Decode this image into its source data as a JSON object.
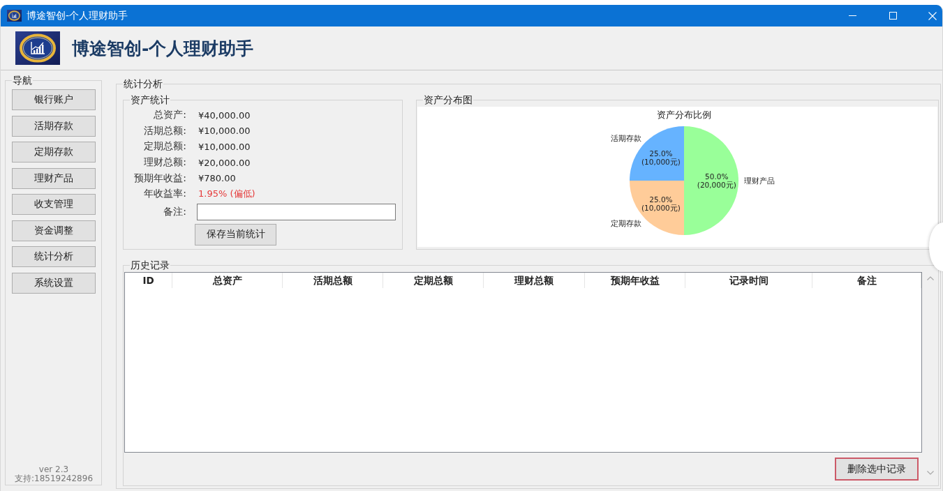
{
  "window": {
    "title": "博途智创-个人理财助手"
  },
  "header": {
    "title": "博途智创-个人理财助手"
  },
  "nav": {
    "title": "导航",
    "items": [
      "银行账户",
      "活期存款",
      "定期存款",
      "理财产品",
      "收支管理",
      "资金调整",
      "统计分析",
      "系统设置"
    ],
    "footer": {
      "version": "ver 2.3",
      "support": "支持:18519242896"
    }
  },
  "panel": {
    "title": "统计分析",
    "summary": {
      "title": "资产统计",
      "rows": [
        {
          "label": "总资产:",
          "value": "¥40,000.00",
          "alert": false
        },
        {
          "label": "活期总额:",
          "value": "¥10,000.00",
          "alert": false
        },
        {
          "label": "定期总额:",
          "value": "¥10,000.00",
          "alert": false
        },
        {
          "label": "理财总额:",
          "value": "¥20,000.00",
          "alert": false
        },
        {
          "label": "预期年收益:",
          "value": "¥780.00",
          "alert": false
        },
        {
          "label": "年收益率:",
          "value": "1.95% (偏低)",
          "alert": true
        }
      ],
      "note": {
        "label": "备注:"
      },
      "save_button": "保存当前统计"
    },
    "distribution": {
      "title": "资产分布图",
      "chart_data": {
        "type": "pie",
        "title": "资产分布比例",
        "categories": [
          "活期存款",
          "定期存款",
          "理财产品"
        ],
        "values": [
          10000,
          10000,
          20000
        ],
        "colors": [
          "#66b3ff",
          "#ffcc99",
          "#99ff99"
        ],
        "value_labels": [
          "25.0%\n(10,000元)",
          "25.0%\n(10,000元)",
          "50.0%\n(20,000元)"
        ]
      }
    },
    "history": {
      "title": "历史记录",
      "table": {
        "columns": [
          "ID",
          "总资产",
          "活期总额",
          "定期总额",
          "理财总额",
          "预期年收益",
          "记录时间",
          "备注"
        ]
      },
      "delete_button": "删除选中记录"
    }
  }
}
